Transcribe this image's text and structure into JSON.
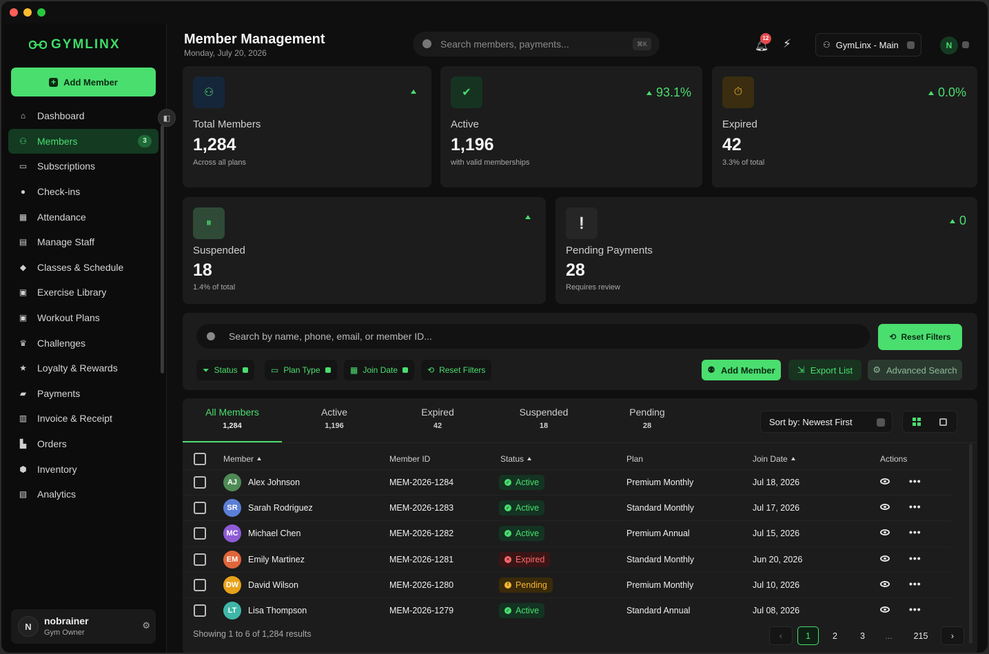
{
  "app": {
    "logo": "GYMLINX",
    "window_dots": [
      "#ff5f57",
      "#febc2e",
      "#28c840"
    ]
  },
  "sidebar": {
    "add_member": "Add Member",
    "items": [
      {
        "label": "Dashboard",
        "icon": "home-icon"
      },
      {
        "label": "Members",
        "icon": "users-icon",
        "badge": "3",
        "active": true
      },
      {
        "label": "Subscriptions",
        "icon": "card-icon"
      },
      {
        "label": "Check-ins",
        "icon": "pin-icon"
      },
      {
        "label": "Attendance",
        "icon": "calendar-icon"
      },
      {
        "label": "Manage Staff",
        "icon": "id-card-icon"
      },
      {
        "label": "Classes & Schedule",
        "icon": "graduation-icon"
      },
      {
        "label": "Exercise Library",
        "icon": "book-icon"
      },
      {
        "label": "Workout Plans",
        "icon": "clipboard-icon"
      },
      {
        "label": "Challenges",
        "icon": "trophy-icon"
      },
      {
        "label": "Loyalty & Rewards",
        "icon": "star-icon"
      },
      {
        "label": "Payments",
        "icon": "wallet-icon"
      },
      {
        "label": "Invoice & Receipt",
        "icon": "receipt-icon"
      },
      {
        "label": "Orders",
        "icon": "bag-icon"
      },
      {
        "label": "Inventory",
        "icon": "box-icon"
      },
      {
        "label": "Analytics",
        "icon": "chart-icon"
      }
    ],
    "user": {
      "initial": "N",
      "name": "nobrainer",
      "role": "Gym Owner"
    }
  },
  "header": {
    "title": "Member Management",
    "date": "Monday, July 20, 2026",
    "search_placeholder": "Search members, payments...",
    "search_shortcut": "⌘K",
    "notifications": "12",
    "workspace": "GymLinx - Main",
    "avatar": "N"
  },
  "stats": [
    {
      "label": "Total Members",
      "value": "1,284",
      "sub": "Across all plans",
      "trend": "",
      "icon": "users-icon"
    },
    {
      "label": "Active",
      "value": "1,196",
      "sub": "with valid memberships",
      "trend": "93.1%",
      "icon": "check-icon"
    },
    {
      "label": "Expired",
      "value": "42",
      "sub": "3.3% of total",
      "trend": "0.0%",
      "icon": "stopwatch-icon"
    },
    {
      "label": "Suspended",
      "value": "18",
      "sub": "1.4% of total",
      "trend": "",
      "icon": "pause-icon"
    },
    {
      "label": "Pending Payments",
      "value": "28",
      "sub": "Requires review",
      "trend": "0",
      "icon": "alert-icon"
    }
  ],
  "filters": {
    "search_placeholder": "Search by name, phone, email, or member ID...",
    "reset_filters_primary": "Reset Filters",
    "chips": [
      "Status",
      "Plan Type",
      "Join Date"
    ],
    "reset_filters": "Reset Filters",
    "add_member": "Add Member",
    "export_list": "Export List",
    "advanced_search": "Advanced Search"
  },
  "tabs": [
    {
      "label": "All Members",
      "count": "1,284",
      "active": true
    },
    {
      "label": "Active",
      "count": "1,196"
    },
    {
      "label": "Expired",
      "count": "42"
    },
    {
      "label": "Suspended",
      "count": "18"
    },
    {
      "label": "Pending",
      "count": "28"
    }
  ],
  "sort": "Sort by: Newest First",
  "table": {
    "columns": [
      "Member",
      "Member ID",
      "Status",
      "Plan",
      "Join Date",
      "Actions"
    ],
    "rows": [
      {
        "initials": "AJ",
        "name": "Alex Johnson",
        "id": "MEM-2026-1284",
        "status": "Active",
        "plan": "Premium Monthly",
        "joined": "Jul 18, 2026",
        "color": "#4f8a56"
      },
      {
        "initials": "SR",
        "name": "Sarah Rodriguez",
        "id": "MEM-2026-1283",
        "status": "Active",
        "plan": "Standard Monthly",
        "joined": "Jul 17, 2026",
        "color": "#5b7fd6"
      },
      {
        "initials": "MC",
        "name": "Michael Chen",
        "id": "MEM-2026-1282",
        "status": "Active",
        "plan": "Premium Annual",
        "joined": "Jul 15, 2026",
        "color": "#8e5bd6"
      },
      {
        "initials": "EM",
        "name": "Emily Martinez",
        "id": "MEM-2026-1281",
        "status": "Expired",
        "plan": "Standard Monthly",
        "joined": "Jun 20, 2026",
        "color": "#e0653a"
      },
      {
        "initials": "DW",
        "name": "David Wilson",
        "id": "MEM-2026-1280",
        "status": "Pending",
        "plan": "Premium Monthly",
        "joined": "Jul 10, 2026",
        "color": "#e8a21a"
      },
      {
        "initials": "LT",
        "name": "Lisa Thompson",
        "id": "MEM-2026-1279",
        "status": "Active",
        "plan": "Standard Annual",
        "joined": "Jul 08, 2026",
        "color": "#3fb6a8"
      }
    ]
  },
  "footer": {
    "showing": "Showing 1 to 6 of 1,284 results",
    "pages": [
      "1",
      "2",
      "3",
      "...",
      "215"
    ]
  }
}
